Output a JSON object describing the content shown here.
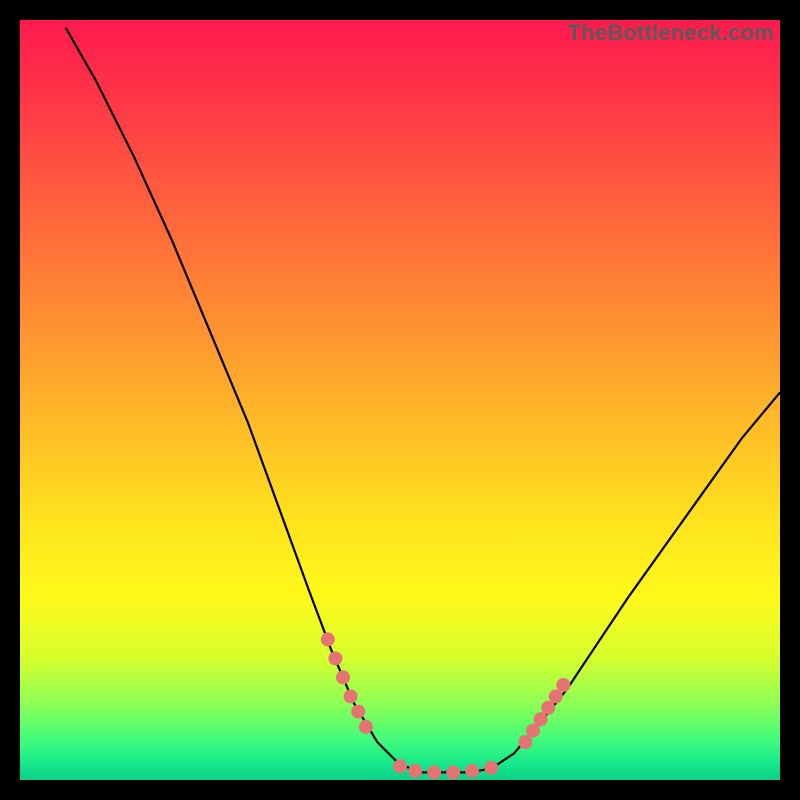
{
  "watermark": "TheBottleneck.com",
  "colors": {
    "background": "#000000",
    "curve": "#000000",
    "marker": "#e57373",
    "gradient_top": "#ff1a4e",
    "gradient_bottom": "#0cd18a"
  },
  "chart_data": {
    "type": "line",
    "title": "",
    "xlabel": "",
    "ylabel": "",
    "xlim": [
      0,
      100
    ],
    "ylim": [
      0,
      100
    ],
    "grid": false,
    "legend": null,
    "curve": {
      "description": "V-shaped bottleneck curve; left branch falls steeply from top-left to a flat trough, right branch rises gently toward mid-right.",
      "points": [
        {
          "x": 6,
          "y": 99
        },
        {
          "x": 10,
          "y": 92
        },
        {
          "x": 15,
          "y": 82
        },
        {
          "x": 20,
          "y": 71
        },
        {
          "x": 25,
          "y": 59
        },
        {
          "x": 30,
          "y": 47
        },
        {
          "x": 34,
          "y": 36
        },
        {
          "x": 38,
          "y": 25
        },
        {
          "x": 41,
          "y": 17
        },
        {
          "x": 44,
          "y": 10
        },
        {
          "x": 47,
          "y": 5
        },
        {
          "x": 50,
          "y": 2
        },
        {
          "x": 53,
          "y": 1
        },
        {
          "x": 56,
          "y": 1
        },
        {
          "x": 59,
          "y": 1
        },
        {
          "x": 62,
          "y": 1.5
        },
        {
          "x": 65,
          "y": 3.5
        },
        {
          "x": 68,
          "y": 7
        },
        {
          "x": 72,
          "y": 12
        },
        {
          "x": 76,
          "y": 18
        },
        {
          "x": 80,
          "y": 24
        },
        {
          "x": 85,
          "y": 31
        },
        {
          "x": 90,
          "y": 38
        },
        {
          "x": 95,
          "y": 45
        },
        {
          "x": 100,
          "y": 51
        }
      ]
    },
    "markers": {
      "description": "Highlighted salmon data points near trough and on both inner slopes.",
      "points": [
        {
          "x": 40.5,
          "y": 18.5
        },
        {
          "x": 41.5,
          "y": 16.0
        },
        {
          "x": 42.5,
          "y": 13.5
        },
        {
          "x": 43.5,
          "y": 11.0
        },
        {
          "x": 44.5,
          "y": 9.0
        },
        {
          "x": 45.5,
          "y": 7.0
        },
        {
          "x": 50.0,
          "y": 1.8
        },
        {
          "x": 52.0,
          "y": 1.2
        },
        {
          "x": 54.5,
          "y": 1.0
        },
        {
          "x": 57.0,
          "y": 1.0
        },
        {
          "x": 59.5,
          "y": 1.2
        },
        {
          "x": 62.0,
          "y": 1.6
        },
        {
          "x": 66.5,
          "y": 5.0
        },
        {
          "x": 67.5,
          "y": 6.5
        },
        {
          "x": 68.5,
          "y": 8.0
        },
        {
          "x": 69.5,
          "y": 9.5
        },
        {
          "x": 70.5,
          "y": 11.0
        },
        {
          "x": 71.5,
          "y": 12.5
        }
      ],
      "radius": 7
    }
  }
}
